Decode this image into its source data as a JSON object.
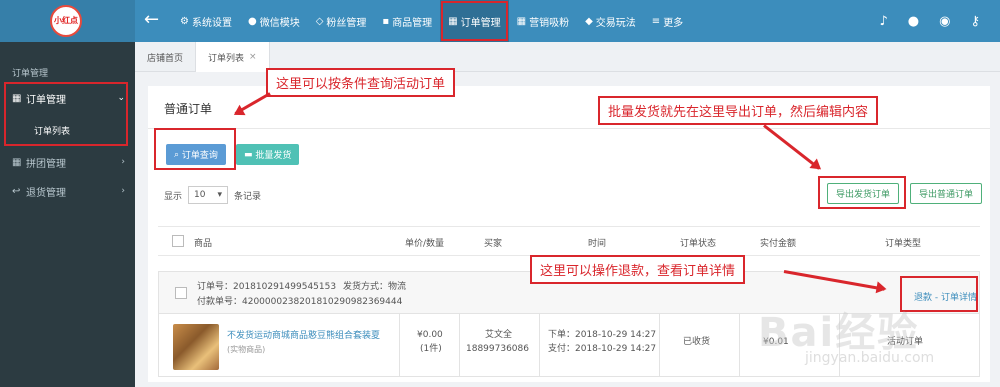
{
  "logo": {
    "text": "小红点"
  },
  "topnav": {
    "back_icon": "arrow-left-icon",
    "items": [
      {
        "label": "系统设置",
        "icon": "gear-icon"
      },
      {
        "label": "微信模块",
        "icon": "chat-icon"
      },
      {
        "label": "粉丝管理",
        "icon": "diamond-icon"
      },
      {
        "label": "商品管理",
        "icon": "cart-icon"
      },
      {
        "label": "订单管理",
        "icon": "calendar-icon",
        "active": true
      },
      {
        "label": "营销吸粉",
        "icon": "grid-icon"
      },
      {
        "label": "交易玩法",
        "icon": "tag-icon"
      },
      {
        "label": "更多",
        "icon": "menu-icon"
      }
    ],
    "right_icons": [
      "bell-icon",
      "wechat-icon",
      "user-icon",
      "key-icon"
    ]
  },
  "sidebar": {
    "section_title": "订单管理",
    "items": [
      {
        "label": "订单管理",
        "icon": "calendar-icon",
        "expanded": true
      },
      {
        "label": "拼团管理",
        "icon": "grid-icon"
      },
      {
        "label": "退货管理",
        "icon": "reply-icon"
      }
    ],
    "subitem": "订单列表"
  },
  "tabs": [
    {
      "label": "店铺首页"
    },
    {
      "label": "订单列表",
      "close": "×",
      "active": true
    }
  ],
  "panel": {
    "title": "普通订单",
    "query_button": "订单查询",
    "ship_button": "批量发货",
    "show_prefix": "显示",
    "page_size": "10",
    "show_suffix": "条记录",
    "export_ship_button": "导出发货订单",
    "export_normal_button": "导出普通订单"
  },
  "table": {
    "headers": [
      "商品",
      "单价/数量",
      "买家",
      "时间",
      "订单状态",
      "实付金额",
      "订单类型"
    ]
  },
  "order": {
    "order_no": "订单号：201810291499545153",
    "ship_method": "发货方式：物流",
    "pay_no": "付款单号：4200000238201810290982369444",
    "actions": "退款 - 订单详情",
    "product_name": "不发货运动商城商品憨豆熊组合套装夏",
    "product_type": "(实物商品)",
    "price": "¥0.00",
    "qty": "(1件)",
    "buyer_name": "艾文全",
    "buyer_phone": "18899736086",
    "order_time": "下单：2018-10-29 14:27",
    "pay_time": "支付：2018-10-29 14:27",
    "status": "已收货",
    "amount": "¥0.01",
    "type": "活动订单"
  },
  "annotations": {
    "query": "这里可以按条件查询活动订单",
    "export": "批量发货就先在这里导出订单，然后编辑内容",
    "refund": "这里可以操作退款，查看订单详情"
  },
  "watermark": {
    "main": "Bai经验",
    "sub": "jingyan.baidu.com"
  },
  "colors": {
    "topbar": "#3c8dbc",
    "sidebar": "#2c3b41",
    "annotation": "#d9262c"
  }
}
